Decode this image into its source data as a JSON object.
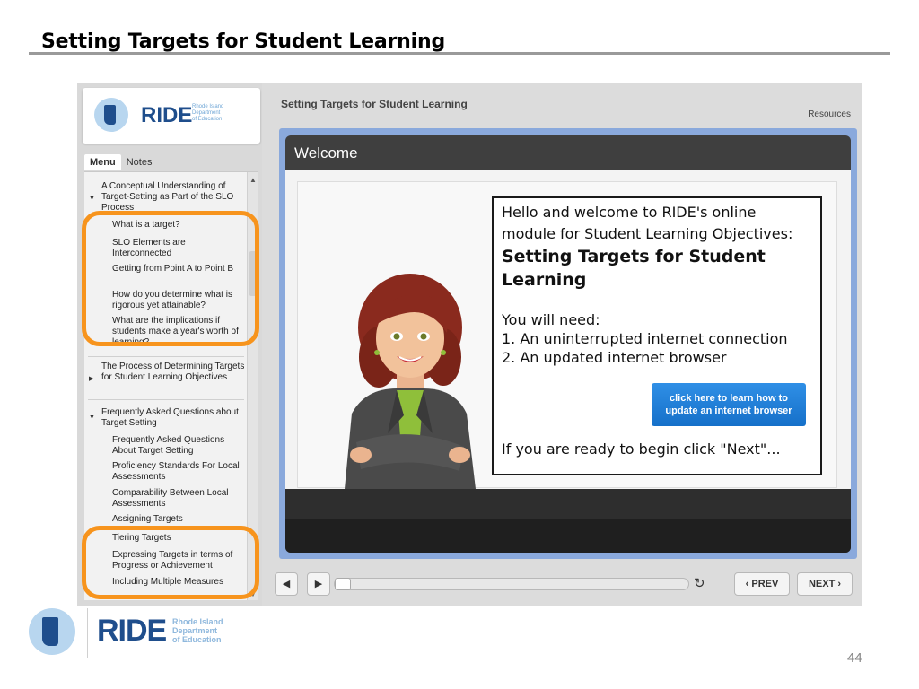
{
  "slide": {
    "title": "Setting Targets for Student Learning",
    "page_number": "44"
  },
  "sidebar": {
    "logo_text": "RIDE",
    "logo_sub": [
      "Rhode Island",
      "Department",
      "of Education"
    ],
    "tabs": [
      "Menu",
      "Notes"
    ],
    "sections": [
      {
        "label": "A Conceptual Understanding of Target-Setting as Part of the SLO Process",
        "expanded": true
      },
      {
        "label": "The Process of Determining Targets for Student Learning Objectives",
        "expanded": false
      },
      {
        "label": "Frequently Asked Questions about Target Setting",
        "expanded": true
      }
    ],
    "items_section1": [
      "What is a target?",
      "SLO Elements are Interconnected",
      "Getting from Point A to Point B",
      "How do you determine what is rigorous yet attainable?",
      "What are the implications if students make a year's worth of learning?"
    ],
    "items_section3": [
      "Frequently Asked Questions About Target Setting",
      "Proficiency Standards For Local Assessments",
      "Comparability Between Local Assessments",
      "Assigning Targets",
      "Tiering Targets",
      "Expressing Targets in terms of Progress or Achievement",
      "Including Multiple Measures"
    ]
  },
  "player": {
    "header_title": "Setting Targets for Student Learning",
    "resources_label": "Resources",
    "stage_title": "Welcome",
    "welcome_line1": "Hello and welcome to RIDE's online",
    "welcome_line2": "module for Student Learning Objectives:",
    "welcome_bold1": "Setting Targets for Student",
    "welcome_bold2": "Learning",
    "need_line": "You will need:",
    "need_1": "1. An uninterrupted internet connection",
    "need_2": "2. An updated internet browser",
    "browser_button_line1": "click here to learn how to",
    "browser_button_line2": "update an internet browser",
    "ready_line": "If you are ready to begin click  \"Next\"...",
    "progress": 0.0
  },
  "controls": {
    "prev_label": "PREV",
    "next_label": "NEXT"
  },
  "footer": {
    "logo_text": "RIDE",
    "logo_sub": [
      "Rhode Island",
      "Department",
      "of Education"
    ]
  },
  "colors": {
    "ride_blue": "#1f4e8c",
    "highlight_orange": "#f7941d",
    "stage_border": "#8aa9dc",
    "button_blue": "#1f80d8"
  }
}
